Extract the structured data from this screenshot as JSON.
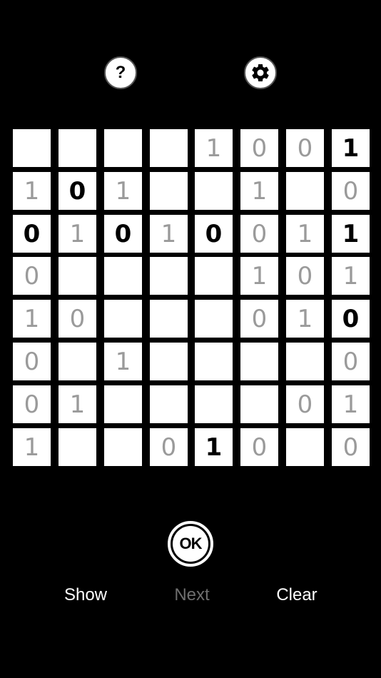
{
  "colors": {
    "background": "#000000",
    "cell": "#ffffff",
    "fixed_digit": "#000000",
    "hint_digit": "#9a9a9a",
    "button_text": "#ffffff",
    "disabled_text": "#6e6e6e"
  },
  "toolbar": {
    "help_label": "?",
    "help_icon": "question-mark-icon",
    "settings_icon": "gear-icon"
  },
  "grid": {
    "rows": 8,
    "cols": 8,
    "cells": [
      [
        {
          "v": ""
        },
        {
          "v": ""
        },
        {
          "v": ""
        },
        {
          "v": ""
        },
        {
          "v": "1",
          "t": "hint"
        },
        {
          "v": "0",
          "t": "hint"
        },
        {
          "v": "0",
          "t": "hint"
        },
        {
          "v": "1",
          "t": "fixed"
        }
      ],
      [
        {
          "v": "1",
          "t": "hint"
        },
        {
          "v": "0",
          "t": "fixed"
        },
        {
          "v": "1",
          "t": "hint"
        },
        {
          "v": ""
        },
        {
          "v": ""
        },
        {
          "v": "1",
          "t": "hint"
        },
        {
          "v": ""
        },
        {
          "v": "0",
          "t": "hint"
        }
      ],
      [
        {
          "v": "0",
          "t": "fixed"
        },
        {
          "v": "1",
          "t": "hint"
        },
        {
          "v": "0",
          "t": "fixed"
        },
        {
          "v": "1",
          "t": "hint"
        },
        {
          "v": "0",
          "t": "fixed"
        },
        {
          "v": "0",
          "t": "hint"
        },
        {
          "v": "1",
          "t": "hint"
        },
        {
          "v": "1",
          "t": "fixed"
        }
      ],
      [
        {
          "v": "0",
          "t": "hint"
        },
        {
          "v": ""
        },
        {
          "v": ""
        },
        {
          "v": ""
        },
        {
          "v": ""
        },
        {
          "v": "1",
          "t": "hint"
        },
        {
          "v": "0",
          "t": "hint"
        },
        {
          "v": "1",
          "t": "hint"
        }
      ],
      [
        {
          "v": "1",
          "t": "hint"
        },
        {
          "v": "0",
          "t": "hint"
        },
        {
          "v": ""
        },
        {
          "v": ""
        },
        {
          "v": ""
        },
        {
          "v": "0",
          "t": "hint"
        },
        {
          "v": "1",
          "t": "hint"
        },
        {
          "v": "0",
          "t": "fixed"
        }
      ],
      [
        {
          "v": "0",
          "t": "hint"
        },
        {
          "v": ""
        },
        {
          "v": "1",
          "t": "hint"
        },
        {
          "v": ""
        },
        {
          "v": ""
        },
        {
          "v": ""
        },
        {
          "v": ""
        },
        {
          "v": "0",
          "t": "hint"
        }
      ],
      [
        {
          "v": "0",
          "t": "hint"
        },
        {
          "v": "1",
          "t": "hint"
        },
        {
          "v": ""
        },
        {
          "v": ""
        },
        {
          "v": ""
        },
        {
          "v": ""
        },
        {
          "v": "0",
          "t": "hint"
        },
        {
          "v": "1",
          "t": "hint"
        }
      ],
      [
        {
          "v": "1",
          "t": "hint"
        },
        {
          "v": ""
        },
        {
          "v": ""
        },
        {
          "v": "0",
          "t": "hint"
        },
        {
          "v": "1",
          "t": "fixed"
        },
        {
          "v": "0",
          "t": "hint"
        },
        {
          "v": ""
        },
        {
          "v": "0",
          "t": "hint"
        }
      ]
    ]
  },
  "actions": {
    "ok_label": "OK",
    "show_label": "Show",
    "next_label": "Next",
    "clear_label": "Clear"
  }
}
